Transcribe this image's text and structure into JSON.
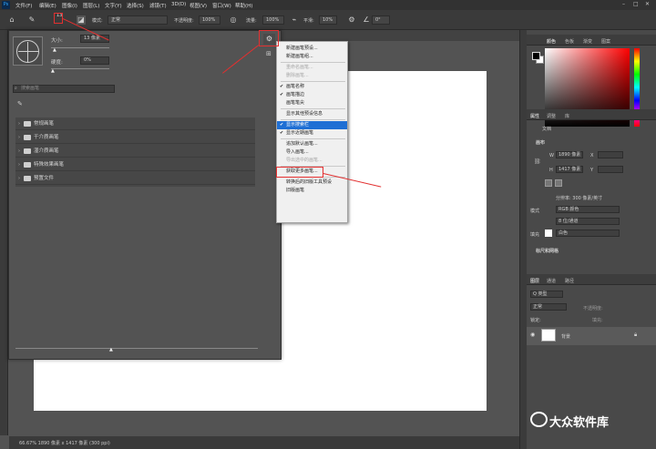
{
  "menubar": {
    "items": [
      "文件(F)",
      "编辑(E)",
      "图像(I)",
      "图层(L)",
      "文字(Y)",
      "选择(S)",
      "滤镜(T)",
      "3D(D)",
      "视图(V)",
      "窗口(W)",
      "帮助(H)"
    ],
    "logo": "Ps"
  },
  "options": {
    "brush_size": "13",
    "mode_label": "模式:",
    "mode_value": "正常",
    "opacity_label": "不透明度:",
    "opacity_value": "100%",
    "flow_label": "流量:",
    "flow_value": "100%",
    "smooth_label": "平滑:",
    "smooth_value": "10%",
    "angle_value": "0°"
  },
  "brush_panel": {
    "size_label": "大小:",
    "size_value": "13 像素",
    "hardness_label": "硬度:",
    "hardness_value": "0%",
    "search_placeholder": "搜索画笔",
    "folders": [
      "常规画笔",
      "干介质画笔",
      "湿介质画笔",
      "特殊效果画笔",
      "预置文件"
    ]
  },
  "context_menu": {
    "items": [
      {
        "label": "新建画笔预设...",
        "state": "normal",
        "checked": false
      },
      {
        "label": "新建画笔组...",
        "state": "normal",
        "checked": false
      },
      {
        "label": "sep"
      },
      {
        "label": "重命名画笔...",
        "state": "disabled",
        "checked": false
      },
      {
        "label": "删除画笔...",
        "state": "disabled",
        "checked": false
      },
      {
        "label": "sep"
      },
      {
        "label": "画笔名称",
        "state": "normal",
        "checked": true
      },
      {
        "label": "画笔描边",
        "state": "normal",
        "checked": true
      },
      {
        "label": "画笔笔尖",
        "state": "normal",
        "checked": false
      },
      {
        "label": "sep"
      },
      {
        "label": "显示其他预设信息",
        "state": "normal",
        "checked": false
      },
      {
        "label": "sep"
      },
      {
        "label": "显示搜索栏",
        "state": "highlight",
        "checked": true
      },
      {
        "label": "显示近期画笔",
        "state": "normal",
        "checked": true
      },
      {
        "label": "sep"
      },
      {
        "label": "追加默认画笔...",
        "state": "normal",
        "checked": false
      },
      {
        "label": "导入画笔...",
        "state": "normal",
        "checked": false
      },
      {
        "label": "导出选中的画笔...",
        "state": "disabled",
        "checked": false
      },
      {
        "label": "sep"
      },
      {
        "label": "获取更多画笔...",
        "state": "normal",
        "checked": false
      },
      {
        "label": "sep"
      },
      {
        "label": "转换后的旧版工具预设",
        "state": "normal",
        "checked": false
      },
      {
        "label": "旧版画笔",
        "state": "normal",
        "checked": false
      }
    ]
  },
  "color_panel": {
    "tabs": [
      "颜色",
      "色板",
      "渐变",
      "图案"
    ]
  },
  "properties_panel": {
    "tabs": [
      "属性",
      "调整",
      "库"
    ],
    "doc_label": "文档",
    "section": "画布",
    "w_label": "W",
    "w_value": "1890 像素",
    "h_label": "H",
    "h_value": "1417 像素",
    "x_label": "X",
    "y_label": "Y",
    "resolution": "分辨率: 300 像素/英寸",
    "mode_label": "模式",
    "mode_value": "RGB 颜色",
    "depth_value": "8 位/通道",
    "fill_label": "填充",
    "fill_value": "白色",
    "rulers": "标尺和网格"
  },
  "layers_panel": {
    "tabs": [
      "图层",
      "通道",
      "路径"
    ],
    "kind_placeholder": "Q 类型",
    "blend": "正常",
    "opacity_label": "不透明度:",
    "lock_label": "锁定:",
    "fill_label": "填充:",
    "layer_name": "背景"
  },
  "status": {
    "text": "66.67%  1890 像素 x 1417 像素 (300 ppi)"
  },
  "watermark": {
    "text": "大众软件库"
  },
  "colors": {
    "accent": "#1f6fd4",
    "annotation": "#e23030"
  }
}
